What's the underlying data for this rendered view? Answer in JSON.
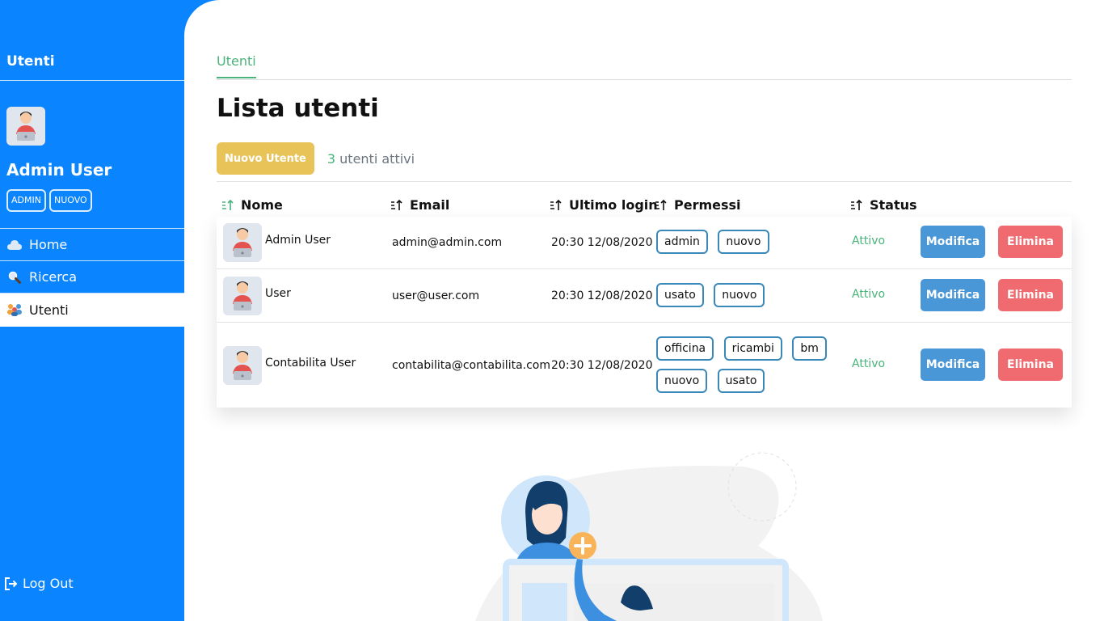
{
  "sidebar": {
    "title": "Utenti",
    "user_name": "Admin User",
    "badges": [
      "ADMIN",
      "NUOVO"
    ],
    "nav": [
      {
        "label": "Home",
        "icon": "cloud-icon"
      },
      {
        "label": "Ricerca",
        "icon": "search-icon"
      },
      {
        "label": "Utenti",
        "icon": "users-icon",
        "active": true
      }
    ],
    "logout": "Log Out"
  },
  "main": {
    "tab": "Utenti",
    "title": "Lista utenti",
    "new_button": "Nuovo Utente",
    "active_count": "3",
    "active_text": "utenti attivi"
  },
  "table": {
    "headers": [
      "Nome",
      "Email",
      "Ultimo login",
      "Permessi",
      "Status"
    ],
    "rows": [
      {
        "name": "Admin User",
        "email": "admin@admin.com",
        "login": "20:30 12/08/2020",
        "perms": [
          "admin",
          "nuovo"
        ],
        "status": "Attivo"
      },
      {
        "name": "User",
        "email": "user@user.com",
        "login": "20:30 12/08/2020",
        "perms": [
          "usato",
          "nuovo"
        ],
        "status": "Attivo"
      },
      {
        "name": "Contabilita User",
        "email": "contabilita@contabilita.com",
        "login": "20:30 12/08/2020",
        "perms": [
          "officina",
          "ricambi",
          "bm",
          "nuovo",
          "usato"
        ],
        "status": "Attivo"
      }
    ],
    "edit_label": "Modifica",
    "delete_label": "Elimina"
  },
  "colors": {
    "sidebar": "#0a84ff",
    "accent_green": "#48b37a",
    "new_button": "#e8c458",
    "edit_button": "#4a97d8",
    "delete_button": "#f06b6f",
    "tag_border": "#3a88b8"
  }
}
